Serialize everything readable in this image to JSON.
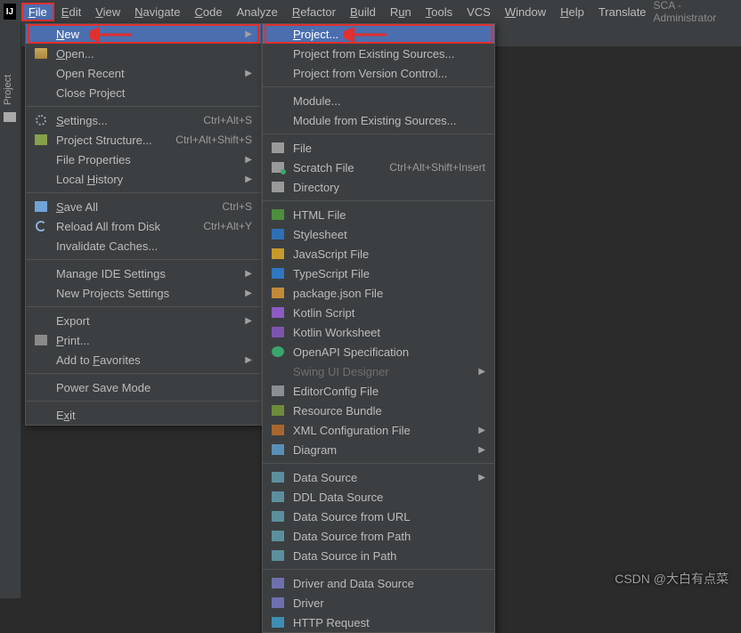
{
  "window": {
    "title": "SCA - Administrator"
  },
  "menubar": {
    "items": [
      {
        "label": "File",
        "mnemIndex": 0
      },
      {
        "label": "Edit",
        "mnemIndex": 0
      },
      {
        "label": "View",
        "mnemIndex": 0
      },
      {
        "label": "Navigate",
        "mnemIndex": 0
      },
      {
        "label": "Code",
        "mnemIndex": 0
      },
      {
        "label": "Analyze",
        "mnemIndex": -1
      },
      {
        "label": "Refactor",
        "mnemIndex": 0
      },
      {
        "label": "Build",
        "mnemIndex": 0
      },
      {
        "label": "Run",
        "mnemIndex": 1
      },
      {
        "label": "Tools",
        "mnemIndex": 0
      },
      {
        "label": "VCS",
        "mnemIndex": -1
      },
      {
        "label": "Window",
        "mnemIndex": 0
      },
      {
        "label": "Help",
        "mnemIndex": 0
      },
      {
        "label": "Translate",
        "mnemIndex": -1
      }
    ]
  },
  "sidebar": {
    "project_label": "Project"
  },
  "file_menu": {
    "items": [
      {
        "label": "New",
        "icon": "",
        "mnem": 0,
        "arrow": true,
        "selected": true,
        "boxed": true
      },
      {
        "label": "Open...",
        "icon": "folder",
        "mnem": 0
      },
      {
        "label": "Open Recent",
        "icon": "",
        "mnem": -1,
        "arrow": true
      },
      {
        "label": "Close Project",
        "icon": "",
        "mnem": -1
      },
      {
        "sep": true
      },
      {
        "label": "Settings...",
        "icon": "gear",
        "mnem": 0,
        "shortcut": "Ctrl+Alt+S"
      },
      {
        "label": "Project Structure...",
        "icon": "folder2",
        "mnem": -1,
        "shortcut": "Ctrl+Alt+Shift+S"
      },
      {
        "label": "File Properties",
        "icon": "",
        "mnem": -1,
        "arrow": true
      },
      {
        "label": "Local History",
        "icon": "",
        "mnem": 6,
        "arrow": true
      },
      {
        "sep": true
      },
      {
        "label": "Save All",
        "icon": "disk",
        "mnem": 0,
        "shortcut": "Ctrl+S"
      },
      {
        "label": "Reload All from Disk",
        "icon": "reload",
        "mnem": -1,
        "shortcut": "Ctrl+Alt+Y"
      },
      {
        "label": "Invalidate Caches...",
        "icon": "",
        "mnem": -1
      },
      {
        "sep": true
      },
      {
        "label": "Manage IDE Settings",
        "icon": "",
        "mnem": -1,
        "arrow": true
      },
      {
        "label": "New Projects Settings",
        "icon": "",
        "mnem": -1,
        "arrow": true
      },
      {
        "sep": true
      },
      {
        "label": "Export",
        "icon": "",
        "mnem": -1,
        "arrow": true
      },
      {
        "label": "Print...",
        "icon": "print",
        "mnem": 0
      },
      {
        "label": "Add to Favorites",
        "icon": "",
        "mnem": 7,
        "arrow": true
      },
      {
        "sep": true
      },
      {
        "label": "Power Save Mode",
        "icon": "",
        "mnem": -1
      },
      {
        "sep": true
      },
      {
        "label": "Exit",
        "icon": "",
        "mnem": 1
      }
    ]
  },
  "new_menu": {
    "items": [
      {
        "label": "Project...",
        "icon": "",
        "selected": true,
        "boxed": true,
        "mnem": 0
      },
      {
        "label": "Project from Existing Sources...",
        "icon": ""
      },
      {
        "label": "Project from Version Control...",
        "icon": ""
      },
      {
        "sep": true
      },
      {
        "label": "Module...",
        "icon": ""
      },
      {
        "label": "Module from Existing Sources...",
        "icon": ""
      },
      {
        "sep": true
      },
      {
        "label": "File",
        "icon": "fileico"
      },
      {
        "label": "Scratch File",
        "icon": "scratch",
        "shortcut": "Ctrl+Alt+Shift+Insert"
      },
      {
        "label": "Directory",
        "icon": "dirico"
      },
      {
        "sep": true
      },
      {
        "label": "HTML File",
        "icon": "html"
      },
      {
        "label": "Stylesheet",
        "icon": "css"
      },
      {
        "label": "JavaScript File",
        "icon": "js"
      },
      {
        "label": "TypeScript File",
        "icon": "ts"
      },
      {
        "label": "package.json File",
        "icon": "json"
      },
      {
        "label": "Kotlin Script",
        "icon": "kt"
      },
      {
        "label": "Kotlin Worksheet",
        "icon": "ktws"
      },
      {
        "label": "OpenAPI Specification",
        "icon": "api"
      },
      {
        "label": "Swing UI Designer",
        "icon": "",
        "arrow": true,
        "disabled": true
      },
      {
        "label": "EditorConfig File",
        "icon": "gearc"
      },
      {
        "label": "Resource Bundle",
        "icon": "bundle"
      },
      {
        "label": "XML Configuration File",
        "icon": "xml",
        "arrow": true
      },
      {
        "label": "Diagram",
        "icon": "diagram",
        "arrow": true
      },
      {
        "sep": true
      },
      {
        "label": "Data Source",
        "icon": "db",
        "arrow": true
      },
      {
        "label": "DDL Data Source",
        "icon": "db"
      },
      {
        "label": "Data Source from URL",
        "icon": "db"
      },
      {
        "label": "Data Source from Path",
        "icon": "db"
      },
      {
        "label": "Data Source in Path",
        "icon": "db"
      },
      {
        "sep": true
      },
      {
        "label": "Driver and Data Source",
        "icon": "driver"
      },
      {
        "label": "Driver",
        "icon": "driver"
      },
      {
        "label": "HTTP Request",
        "icon": "http"
      }
    ]
  },
  "watermark": "CSDN @大白有点菜"
}
